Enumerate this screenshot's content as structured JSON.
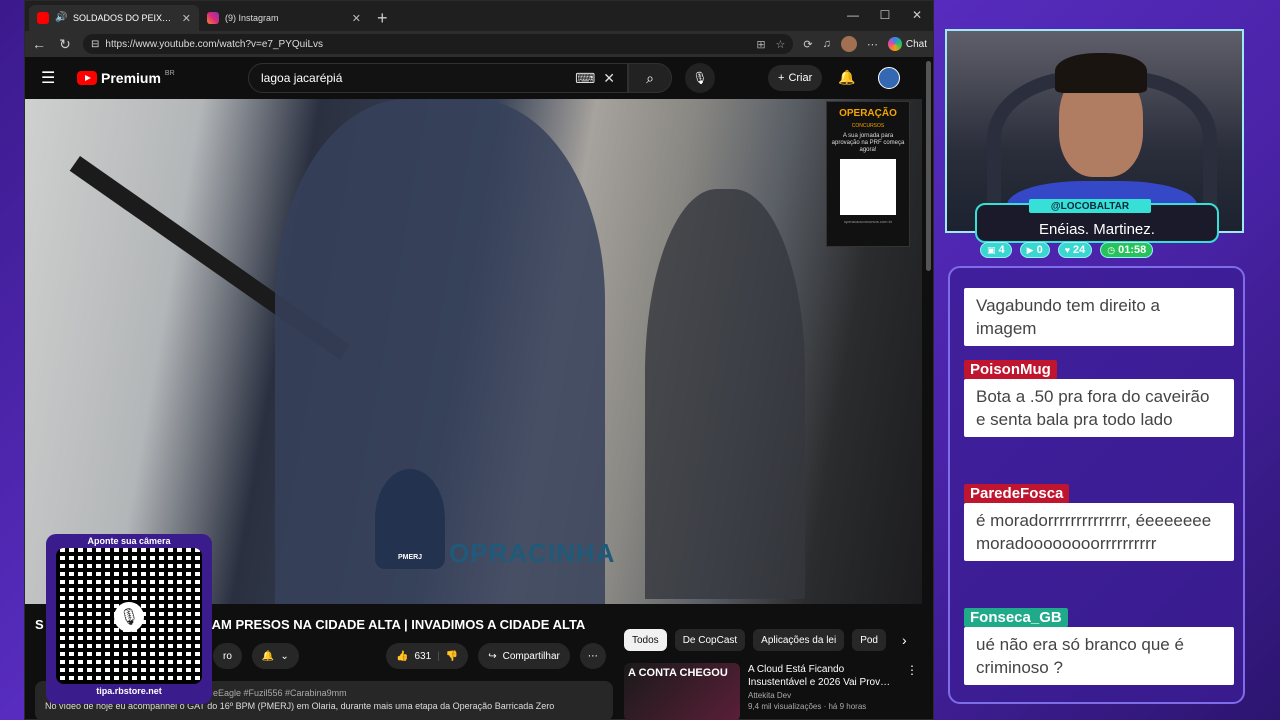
{
  "browser": {
    "tabs": [
      {
        "title": "SOLDADOS DO PEIXÃO FORAM PRESOS",
        "active": true
      },
      {
        "title": "(9) Instagram",
        "active": false
      }
    ],
    "url": "https://www.youtube.com/watch?v=e7_PYQuiLvs",
    "chat_label": "Chat"
  },
  "youtube": {
    "logo": "Premium",
    "region": "BR",
    "search_value": "lagoa jacarépiá",
    "create_label": "Criar",
    "video_title": "SOLDADOS DO PEIXÃO FORAM PRESOS NA CIDADE ALTA | INVADIMOS A CIDADE ALTA",
    "video_title_visible": "S",
    "video_title_rest": "AM PRESOS NA CIDADE ALTA | INVADIMOS A CIDADE ALTA",
    "subscribe_partial": "ro",
    "likes": "631",
    "share_label": "Compartilhar",
    "desc_tags": "eEagle #Fuzil556 #Carabina9mm",
    "desc_text": "No vídeo de hoje eu acompanhei o GAT do 16º BPM (PMERJ) em Olaria, durante mais uma etapa da Operação Barricada Zero",
    "chips": [
      "Todos",
      "De CopCast",
      "Aplicações da lei",
      "Pod"
    ],
    "recommended": {
      "thumb_text": "A CONTA CHEGOU",
      "title": "A Cloud Está Ficando Insustentável e 2026 Vai Prov…",
      "channel": "Attekita Dev",
      "meta": "9,4 mil visualizações · há 9 horas"
    }
  },
  "video_overlay": {
    "ad_brand": "OPERAÇÃO",
    "ad_sub": "CONCURSOS",
    "ad_text": "A sua jornada para aprovação na PRF começa agora!",
    "ad_site": "operacaoconcursos.com.br",
    "watermark_badge": "PMERJ",
    "watermark_text": "OPRACINHA"
  },
  "qr_overlay": {
    "caption": "Aponte sua câmera",
    "site": "tipa.rbstore.net"
  },
  "streamer": {
    "handle": "@LOCOBALTAR",
    "name": "Enéias. Martinez.",
    "stats": [
      {
        "icon": "chat-icon",
        "value": "4"
      },
      {
        "icon": "youtube-icon",
        "value": "0"
      },
      {
        "icon": "heart-icon",
        "value": "24"
      },
      {
        "icon": "clock-icon",
        "value": "01:58"
      }
    ]
  },
  "chat": [
    {
      "user": "",
      "text": "Vagabundo tem direito a imagem"
    },
    {
      "user": "PoisonMug",
      "text": "Bota a .50 pra fora do caveirão e senta bala pra todo lado",
      "color": "#c0152f"
    },
    {
      "user": "ParedeFosca",
      "text": "é moradorrrrrrrrrrrrrr, éeeeeeee moradoooooooorrrrrrrrrr",
      "color": "#c0152f"
    },
    {
      "user": "Fonseca_GB",
      "text": "ué não era só branco que é criminoso ?",
      "color": "#1faa8a"
    }
  ]
}
